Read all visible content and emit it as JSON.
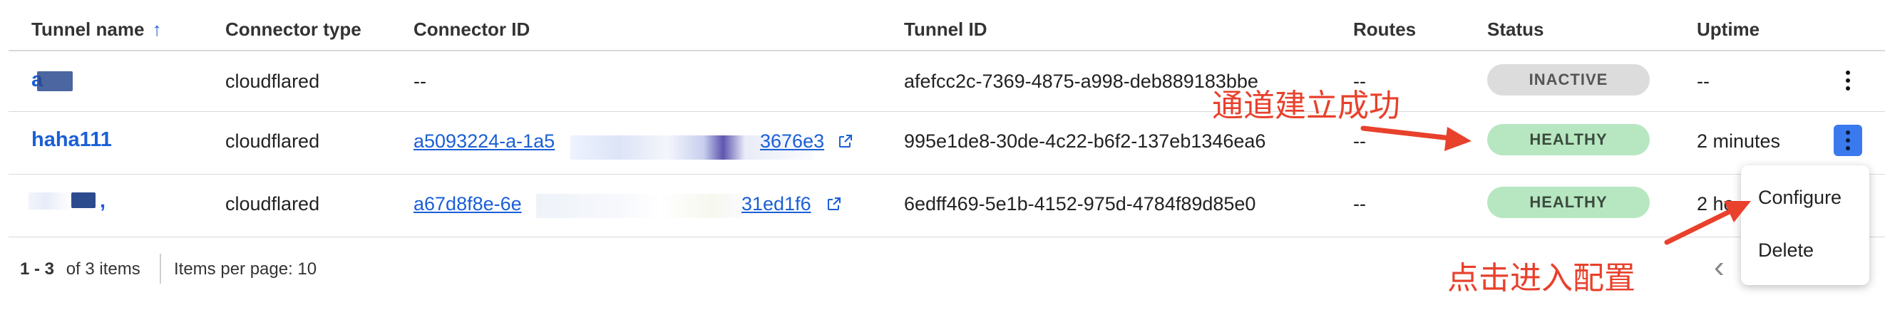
{
  "columns": {
    "tunnel_name": "Tunnel name",
    "sort_icon": "↑",
    "connector_type": "Connector type",
    "connector_id": "Connector ID",
    "tunnel_id": "Tunnel ID",
    "routes": "Routes",
    "status": "Status",
    "uptime": "Uptime"
  },
  "rows": [
    {
      "name": "a",
      "connector_type": "cloudflared",
      "connector_id": "--",
      "tunnel_id": "afefcc2c-7369-4875-a998-deb889183bbe",
      "routes": "--",
      "status": "INACTIVE",
      "uptime": "--"
    },
    {
      "name": "haha111",
      "connector_type": "cloudflared",
      "connector_id_start": "a5093224-a-1a5",
      "connector_id_end": "3676e3",
      "tunnel_id": "995e1de8-30de-4c22-b6f2-137eb1346ea6",
      "routes": "--",
      "status": "HEALTHY",
      "uptime": "2 minutes"
    },
    {
      "name": ",",
      "connector_type": "cloudflared",
      "connector_id_start": "a67d8f8e-6e",
      "connector_id_end": "31ed1f6",
      "tunnel_id": "6edff469-5e1b-4152-975d-4784f89d85e0",
      "routes": "--",
      "status": "HEALTHY",
      "uptime": "2 ho"
    }
  ],
  "footer": {
    "range": "1 - 3",
    "of_items": "of 3 items",
    "per_page": "Items per page: 10",
    "prev_icon": "‹"
  },
  "menu": {
    "configure": "Configure",
    "delete": "Delete"
  },
  "annotations": {
    "tunnel_success": "通道建立成功",
    "click_configure": "点击进入配置"
  },
  "colors": {
    "link": "#1a5fd6",
    "healthy_bg": "#b7e7c1",
    "inactive_bg": "#dcdcdc",
    "kebab_active": "#3b79ee",
    "annotation": "#e8412c"
  }
}
